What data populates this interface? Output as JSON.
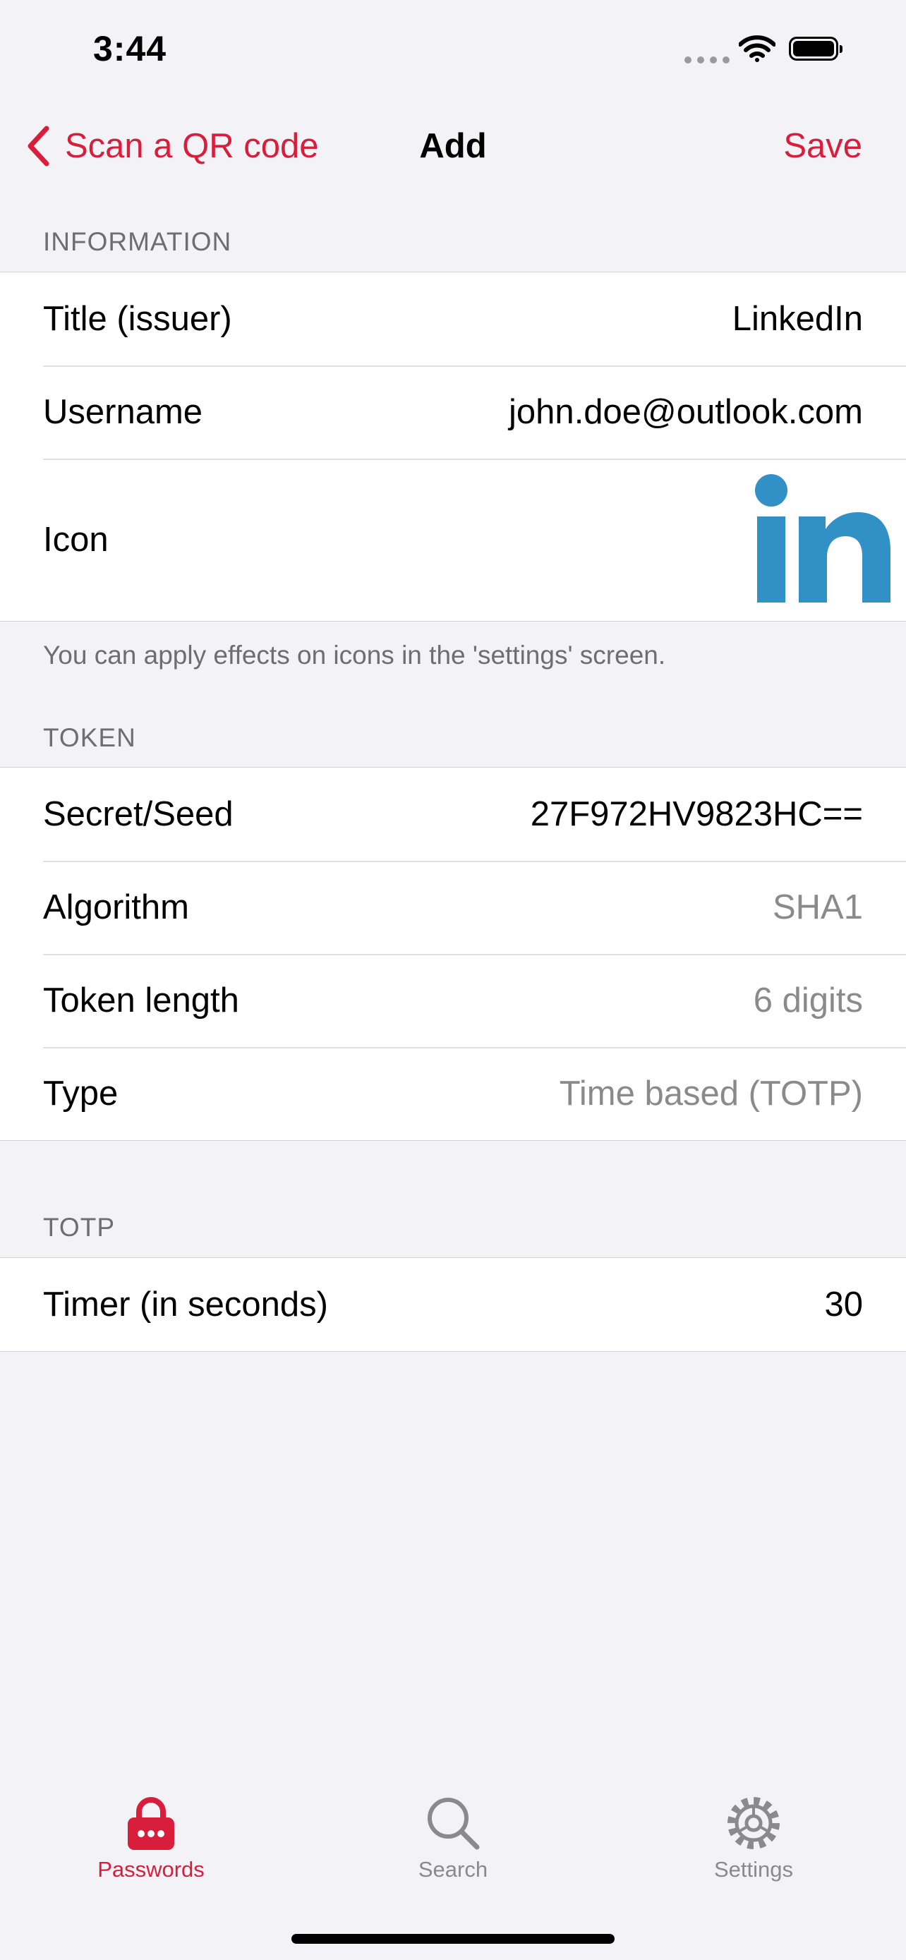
{
  "status_bar": {
    "time": "3:44"
  },
  "nav": {
    "back_label": "Scan a QR code",
    "title": "Add",
    "save_label": "Save"
  },
  "sections": {
    "information": {
      "header": "INFORMATION",
      "rows": [
        {
          "label": "Title (issuer)",
          "value": "LinkedIn"
        },
        {
          "label": "Username",
          "value": "john.doe@outlook.com"
        },
        {
          "label": "Icon"
        }
      ],
      "footer": "You can apply effects on icons in the 'settings' screen."
    },
    "token": {
      "header": "TOKEN",
      "rows": [
        {
          "label": "Secret/Seed",
          "value": "27F972HV9823HC=="
        },
        {
          "label": "Algorithm",
          "value": "SHA1"
        },
        {
          "label": "Token length",
          "value": "6 digits"
        },
        {
          "label": "Type",
          "value": "Time based (TOTP)"
        }
      ]
    },
    "totp": {
      "header": "TOTP",
      "rows": [
        {
          "label": "Timer (in seconds)",
          "value": "30"
        }
      ]
    }
  },
  "tab_bar": {
    "items": [
      {
        "label": "Passwords",
        "icon": "lock-icon",
        "selected": true
      },
      {
        "label": "Search",
        "icon": "search-icon",
        "selected": false
      },
      {
        "label": "Settings",
        "icon": "gear-icon",
        "selected": false
      }
    ]
  },
  "colors": {
    "accent": "#d91e3c",
    "background": "#f2f2f7",
    "secondary_text": "#8a8a8e",
    "linkedin_blue": "#3190c6"
  }
}
